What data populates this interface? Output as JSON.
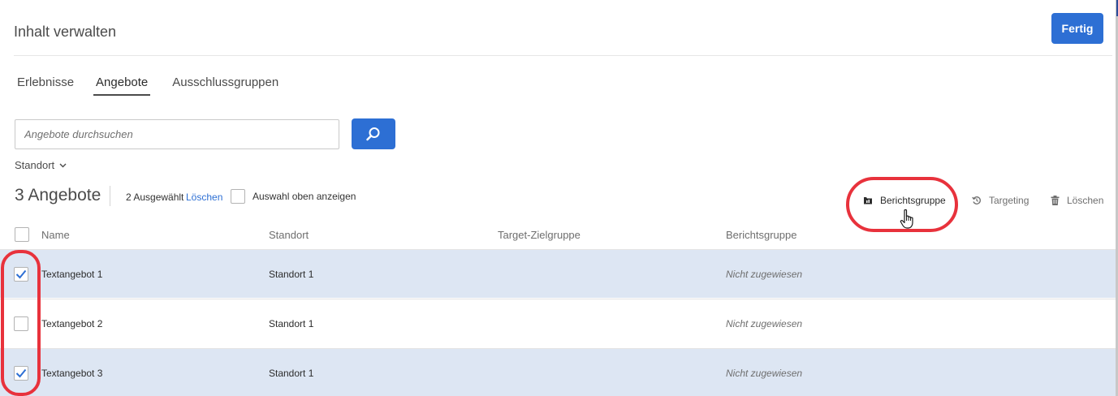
{
  "header": {
    "title": "Inhalt verwalten",
    "done_label": "Fertig"
  },
  "tabs": [
    {
      "label": "Erlebnisse",
      "active": false
    },
    {
      "label": "Angebote",
      "active": true
    },
    {
      "label": "Ausschlussgruppen",
      "active": false
    }
  ],
  "search": {
    "placeholder": "Angebote durchsuchen",
    "value": "",
    "button_icon": "search-icon"
  },
  "filter": {
    "location_label": "Standort",
    "icon": "chevron-down-icon"
  },
  "summary": {
    "count_label": "3 Angebote",
    "selected_text": "2 Ausgewählt",
    "delete_link": "Löschen",
    "show_top_label": "Auswahl oben anzeigen",
    "show_top_checked": false
  },
  "actions": [
    {
      "label": "Berichtsgruppe",
      "icon": "report-group-icon"
    },
    {
      "label": "Targeting",
      "icon": "targeting-icon"
    },
    {
      "label": "Löschen",
      "icon": "trash-icon"
    }
  ],
  "table": {
    "columns": [
      "Name",
      "Standort",
      "Target-Zielgruppe",
      "Berichtsgruppe"
    ],
    "rows": [
      {
        "checked": true,
        "name": "Textangebot 1",
        "location": "Standort 1",
        "audience": "",
        "report_group": "Nicht zugewiesen"
      },
      {
        "checked": false,
        "name": "Textangebot 2",
        "location": "Standort 1",
        "audience": "",
        "report_group": "Nicht zugewiesen"
      },
      {
        "checked": true,
        "name": "Textangebot 3",
        "location": "Standort 1",
        "audience": "",
        "report_group": "Nicht zugewiesen"
      }
    ]
  },
  "colors": {
    "accent": "#2d6fd4",
    "selected_row": "#dde6f3",
    "annotation": "#e8323c"
  }
}
